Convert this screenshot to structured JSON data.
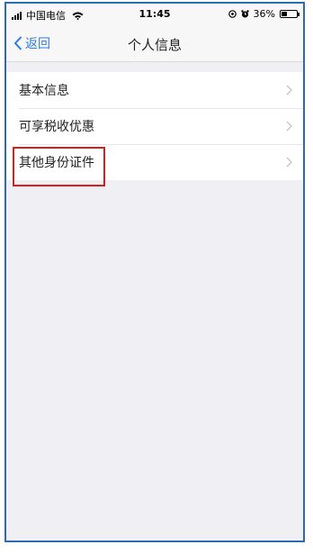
{
  "status_bar": {
    "carrier": "中国电信",
    "time": "11:45",
    "battery_percent": "36%",
    "battery_level": 0.36,
    "icons": [
      "signal-icon",
      "wifi-icon",
      "location-icon",
      "alarm-icon",
      "battery-icon"
    ]
  },
  "nav": {
    "back_label": "返回",
    "title": "个人信息"
  },
  "list": {
    "items": [
      {
        "label": "基本信息"
      },
      {
        "label": "可享税收优惠"
      },
      {
        "label": "其他身份证件",
        "highlighted": true
      }
    ]
  },
  "colors": {
    "accent": "#2f7de1",
    "frame": "#2d6cb5",
    "highlight": "#d81e1e",
    "background": "#efeff4"
  }
}
